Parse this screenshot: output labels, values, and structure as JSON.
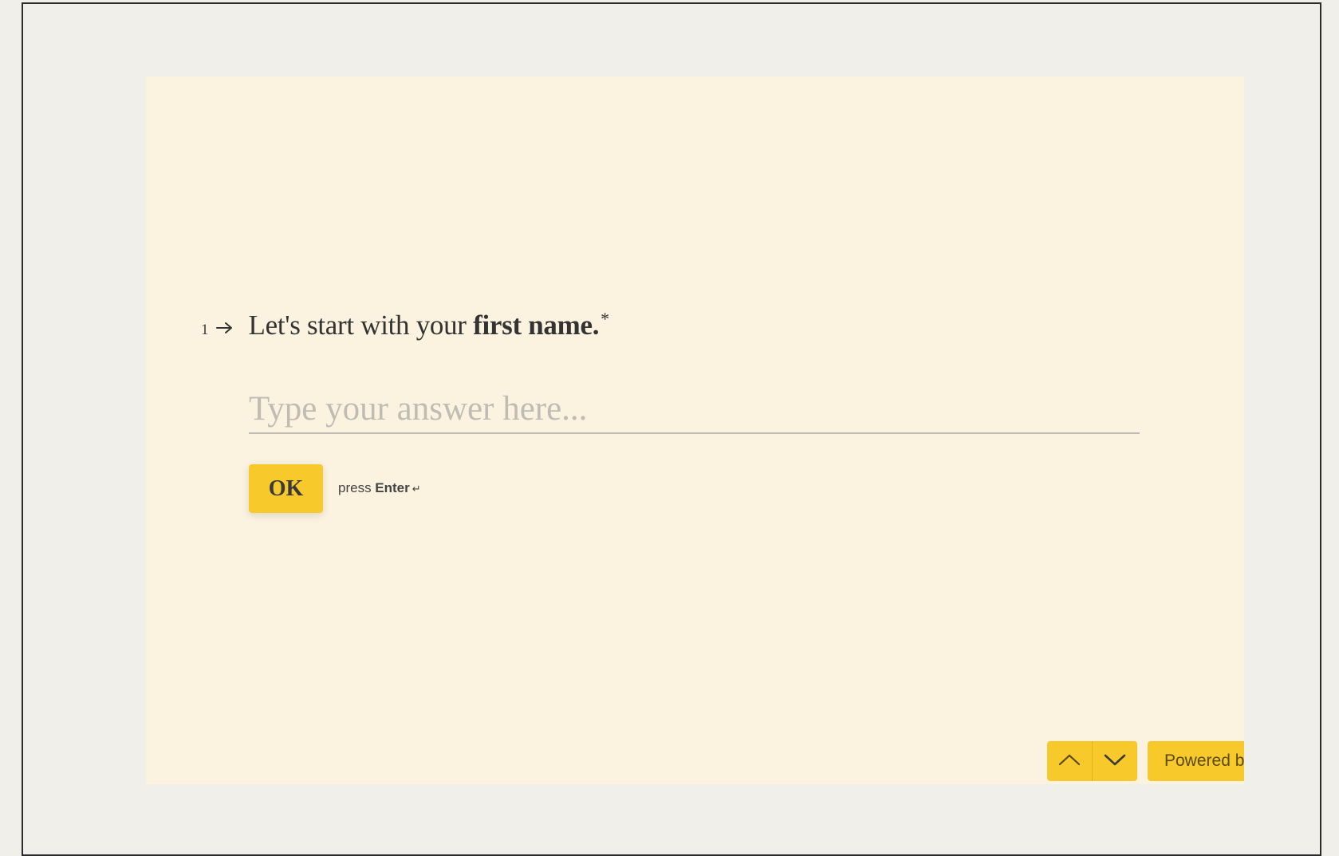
{
  "question": {
    "number": "1",
    "text_prefix": "Let's start with your ",
    "text_bold": "first name.",
    "required_marker": "*"
  },
  "answer": {
    "placeholder": "Type your answer here...",
    "value": ""
  },
  "actions": {
    "ok_label": "OK",
    "hint_prefix": "press ",
    "hint_key": "Enter",
    "hint_icon": "↵"
  },
  "navigation": {
    "up_icon": "chevron-up-icon",
    "down_icon": "chevron-down-icon"
  },
  "footer": {
    "powered_label": "Powered by"
  },
  "colors": {
    "page_background": "#f0efe9",
    "card_background": "#fbf3df",
    "accent": "#f8c92b",
    "text": "#333333",
    "placeholder": "#bfbcb4"
  }
}
